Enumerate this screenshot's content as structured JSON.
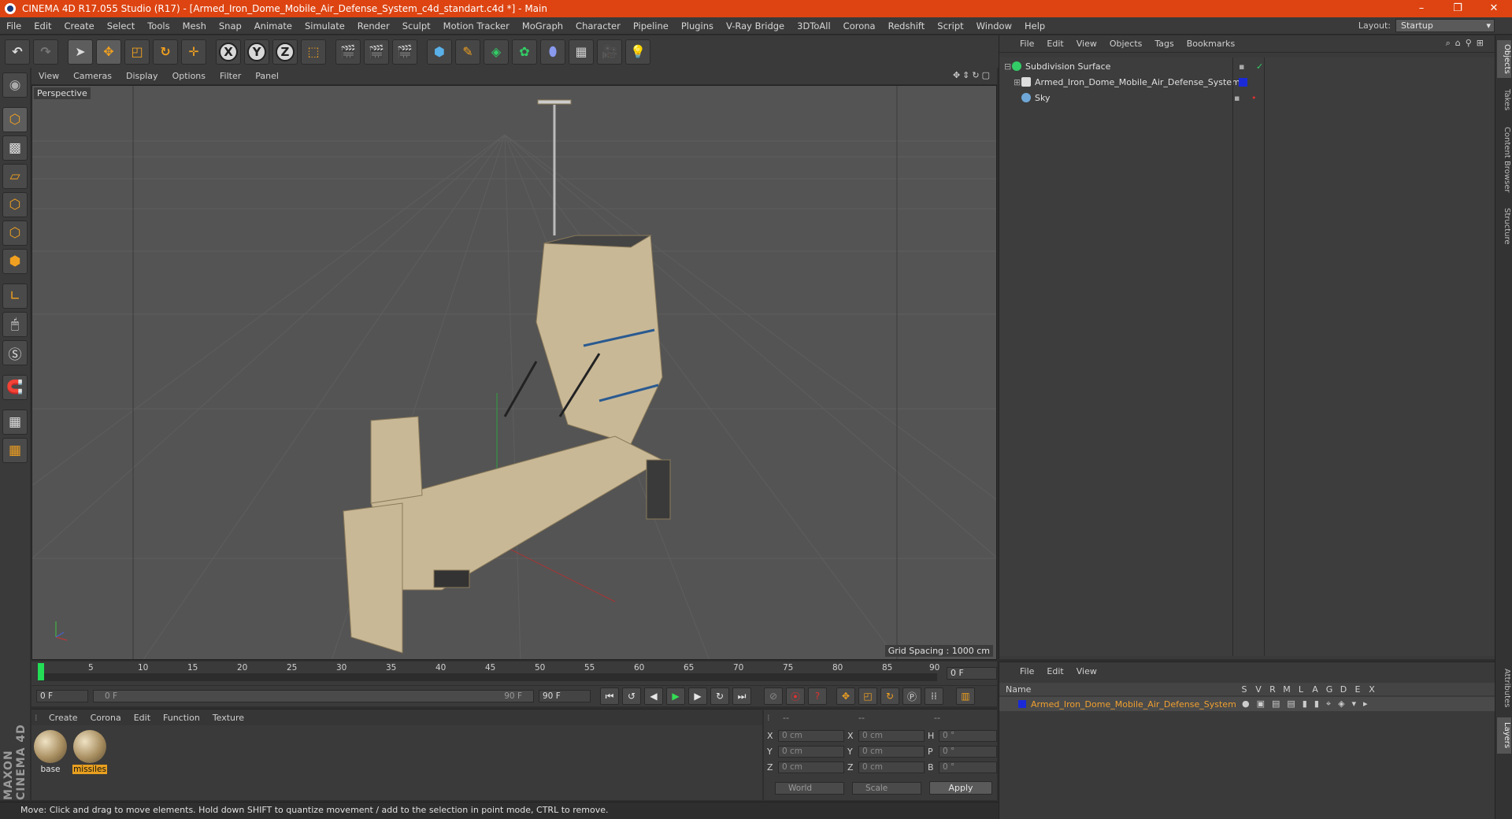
{
  "window": {
    "title": "CINEMA 4D R17.055 Studio (R17) - [Armed_Iron_Dome_Mobile_Air_Defense_System_c4d_standart.c4d *] - Main"
  },
  "menu": [
    "File",
    "Edit",
    "Create",
    "Select",
    "Tools",
    "Mesh",
    "Snap",
    "Animate",
    "Simulate",
    "Render",
    "Sculpt",
    "Motion Tracker",
    "MoGraph",
    "Character",
    "Pipeline",
    "Plugins",
    "V-Ray Bridge",
    "3DToAll",
    "Corona",
    "Redshift",
    "Script",
    "Window",
    "Help"
  ],
  "layout": {
    "label": "Layout:",
    "value": "Startup"
  },
  "viewport": {
    "menu": [
      "View",
      "Cameras",
      "Display",
      "Options",
      "Filter",
      "Panel"
    ],
    "camera": "Perspective",
    "grid_spacing": "Grid Spacing : 1000 cm"
  },
  "timeline": {
    "ticks": [
      "0",
      "5",
      "10",
      "15",
      "20",
      "25",
      "30",
      "35",
      "40",
      "45",
      "50",
      "55",
      "60",
      "65",
      "70",
      "75",
      "80",
      "85",
      "90"
    ],
    "current_frame": "0 F",
    "start": "0 F",
    "range_start": "0 F",
    "range_end": "90 F",
    "end": "90 F"
  },
  "materials": {
    "menu": [
      "Create",
      "Corona",
      "Edit",
      "Function",
      "Texture"
    ],
    "items": [
      {
        "name": "base",
        "selected": false
      },
      {
        "name": "missiles",
        "selected": true
      }
    ]
  },
  "coords": {
    "headers": [
      "--",
      "--",
      "--"
    ],
    "rows": [
      {
        "a": "X",
        "v1": "0 cm",
        "b": "X",
        "v2": "0 cm",
        "c": "H",
        "v3": "0 °"
      },
      {
        "a": "Y",
        "v1": "0 cm",
        "b": "Y",
        "v2": "0 cm",
        "c": "P",
        "v3": "0 °"
      },
      {
        "a": "Z",
        "v1": "0 cm",
        "b": "Z",
        "v2": "0 cm",
        "c": "B",
        "v3": "0 °"
      }
    ],
    "space": "World",
    "mode": "Scale",
    "apply": "Apply"
  },
  "objects": {
    "menu": [
      "File",
      "Edit",
      "View",
      "Objects",
      "Tags",
      "Bookmarks"
    ],
    "items": [
      {
        "name": "Subdivision Surface",
        "icon_color": "#33cc66"
      },
      {
        "name": "Armed_Iron_Dome_Mobile_Air_Defense_System",
        "icon_color": "#dddddd"
      },
      {
        "name": "Sky",
        "icon_color": "#6fa8d8"
      }
    ]
  },
  "layers": {
    "menu": [
      "File",
      "Edit",
      "View"
    ],
    "header_name": "Name",
    "header_cols": [
      "S",
      "V",
      "R",
      "M",
      "L",
      "A",
      "G",
      "D",
      "E",
      "X"
    ],
    "row": "Armed_Iron_Dome_Mobile_Air_Defense_System"
  },
  "sidetabs": [
    "Objects",
    "Takes",
    "Content Browser",
    "Structure",
    "Attributes",
    "Layers"
  ],
  "brand": "MAXON CINEMA 4D",
  "status": "Move: Click and drag to move elements. Hold down SHIFT to quantize movement / add to the selection in point mode, CTRL to remove."
}
